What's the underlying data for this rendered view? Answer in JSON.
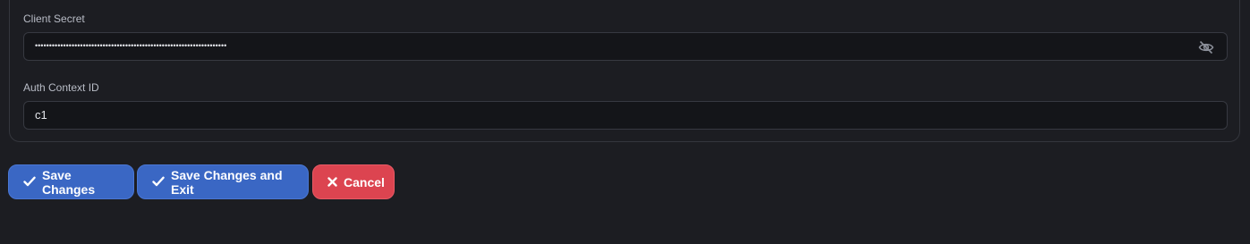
{
  "form": {
    "client_secret": {
      "label": "Client Secret",
      "value": "••••••••••••••••••••••••••••••••••••••••••••••••••••••••••••••••••••"
    },
    "auth_context_id": {
      "label": "Auth Context ID",
      "value": "c1"
    }
  },
  "actions": {
    "save_label": "Save Changes",
    "save_exit_label": "Save Changes and Exit",
    "cancel_label": "Cancel"
  },
  "icons": {
    "visibility_toggle": "eye-slash-icon",
    "save": "check-icon",
    "save_exit": "check-icon",
    "cancel": "x-icon"
  },
  "colors": {
    "background": "#1c1d22",
    "input_background": "#141519",
    "primary": "#3a67c4",
    "danger": "#dc4450"
  }
}
